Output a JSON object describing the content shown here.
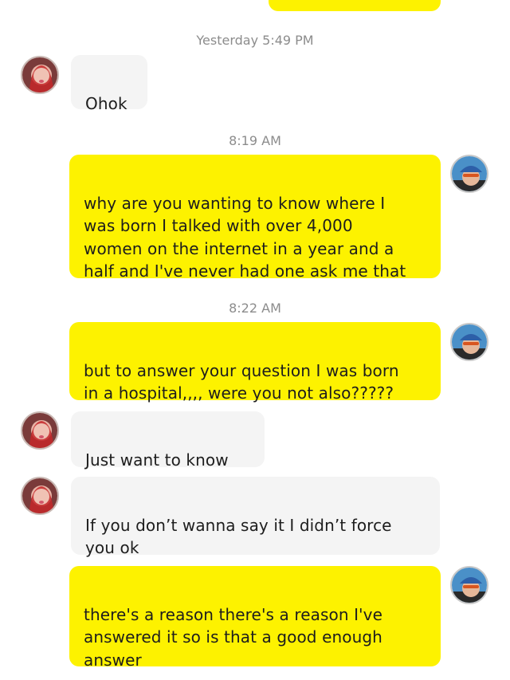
{
  "colors": {
    "sent_bubble": "#fdf200",
    "received_bubble": "#f4f4f4",
    "timestamp": "#8c8c8c"
  },
  "icons": {
    "contact_avatar": "contact-avatar-icon",
    "user_avatar": "user-avatar-icon"
  },
  "timestamps": [
    "Yesterday 5:49 PM",
    "8:19 AM",
    "8:22 AM"
  ],
  "messages": [
    {
      "from": "contact",
      "text": "Ohok"
    },
    {
      "from": "me",
      "text": "why are you wanting to know where I\nwas born I talked with over 4,000\nwomen on the internet in a year and a\nhalf and I've never had one ask me that"
    },
    {
      "from": "me",
      "text": "but to answer your question I was born\nin a hospital,,,,  were you not also?????"
    },
    {
      "from": "contact",
      "text": "Just want to know"
    },
    {
      "from": "contact",
      "text": "If you don’t wanna say it I didn’t force\nyou ok"
    },
    {
      "from": "me",
      "text": "there's a reason there's a reason I've\nanswered it so is that a good enough\nanswer"
    }
  ]
}
